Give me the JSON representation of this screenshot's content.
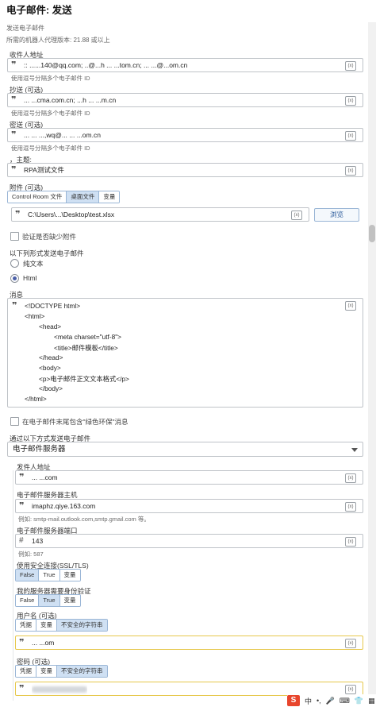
{
  "header": {
    "title": "电子邮件: 发送",
    "subtitle": "发送电子邮件",
    "version": "所需的机器人代理版本: 21.88 或以上"
  },
  "to": {
    "label": "收件人地址",
    "value": " ...@.com;...@.com.cn;...@.com.cn",
    "hint": "使用逗号分隔多个电子邮件 ID",
    "visible": ":: ......140@qq.com; ..@...h ... ...tom.cn; ... ...@...om.cn"
  },
  "cc": {
    "label": "抄送 (可选)",
    "visible": "... ...cma.com.cn; ...h ... ...m.cn",
    "hint": "使用逗号分隔多个电子邮件 ID"
  },
  "bcc": {
    "label": "密送 (可选)",
    "visible": "... ... ...,wq@... ... ...om.cn",
    "hint": "使用逗号分隔多个电子邮件 ID"
  },
  "subject": {
    "label": "，主题:",
    "value": "RPA测试文件"
  },
  "attachment": {
    "label": "附件 (可选)",
    "tabs": [
      "Control Room 文件",
      "桌面文件",
      "变量"
    ],
    "active_tab": 1,
    "path": "C:\\Users\\...\\Desktop\\test.xlsx",
    "browse": "浏览",
    "verify": "验证是否缺少附件"
  },
  "format": {
    "label": "以下列形式发送电子邮件",
    "options": [
      "纯文本",
      "Html"
    ],
    "selected": 1
  },
  "message": {
    "label": "消息",
    "lines": [
      "<!DOCTYPE html>",
      "<html>",
      "<head>",
      "<meta charset=\"utf-8\">",
      "<title>邮件模板</title>",
      "</head>",
      "<body>",
      "<p>电子邮件正文文本格式</p>",
      "</body>",
      "</html>"
    ]
  },
  "green_footer": {
    "label": "在电子邮件末尾包含\"绿色环保\"消息"
  },
  "via": {
    "label": "通过以下方式发送电子邮件",
    "value": "电子邮件服务器"
  },
  "sender": {
    "label": "发件人地址",
    "visible": "... ...com"
  },
  "host": {
    "label": "电子邮件服务器主机",
    "value": "imaphz.qiye.163.com",
    "hint": "例如: smtp-mail.outlook.com,smtp.gmail.com 等。"
  },
  "port": {
    "label": "电子邮件服务器端口",
    "value": "143",
    "hint": "例如: 587"
  },
  "ssl": {
    "label": "使用安全连接(SSL/TLS)",
    "options": [
      "False",
      "True",
      "变量"
    ],
    "selected": 0
  },
  "auth": {
    "label": "我的服务器需要身份验证",
    "options": [
      "False",
      "True",
      "变量"
    ],
    "selected": 1
  },
  "username": {
    "label": "用户名 (可选)",
    "tabs": [
      "凭据",
      "变量",
      "不安全的字符串"
    ],
    "active_tab": 2,
    "visible": "... ...om"
  },
  "password": {
    "label": "密码 (可选)",
    "tabs": [
      "凭据",
      "变量",
      "不安全的字符串"
    ],
    "active_tab": 2
  },
  "ime": {
    "items": [
      "S",
      "中",
      "•,",
      "🎤",
      "⌨",
      "👕",
      "▦"
    ]
  }
}
